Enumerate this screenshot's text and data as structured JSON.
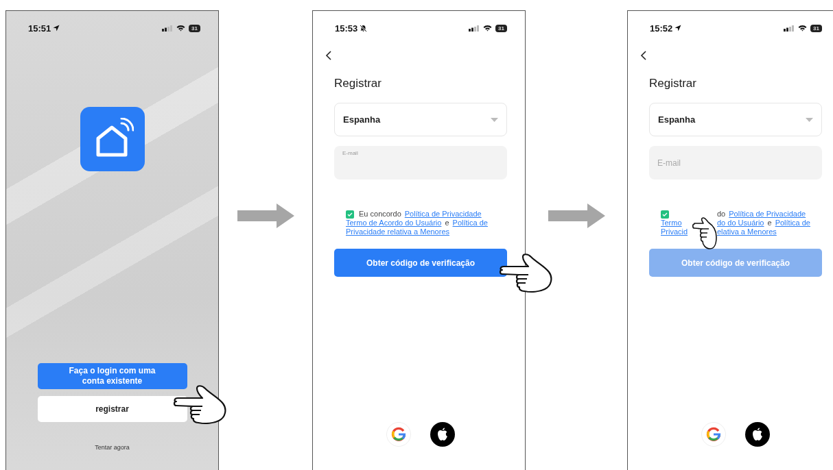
{
  "screens": [
    {
      "kind": "welcome",
      "status": {
        "time": "15:51",
        "indicator": {
          "kind": "location"
        },
        "battery": "31"
      },
      "login_button": "Faça o login com uma conta existente",
      "register_button": "registrar",
      "try_link": "Tentar agora",
      "pointer": {
        "kind": "register"
      }
    },
    {
      "kind": "register",
      "status": {
        "time": "15:53",
        "indicator": {
          "kind": "muted"
        },
        "battery": "31"
      },
      "title": "Registrar",
      "country": "Espanha",
      "email": {
        "placeholder": "E-mail",
        "focused": true
      },
      "consent": {
        "checked": true,
        "lines": [
          {
            "pieces": [
              {
                "text": "Eu concordo",
                "kind": "plain"
              },
              {
                "text": "Política de Privacidade",
                "kind": "link"
              }
            ]
          },
          {
            "pieces": [
              {
                "text": "Termo de Acordo do Usuário",
                "kind": "link"
              },
              {
                "text": "e",
                "kind": "plain"
              },
              {
                "text": "Política de",
                "kind": "link"
              }
            ]
          },
          {
            "pieces": [
              {
                "text": "Privacidade relativa a Menores",
                "kind": "link"
              }
            ]
          }
        ]
      },
      "submit": {
        "label": "Obter código de verificação",
        "disabled": false
      },
      "pointer": {
        "kind": "submit"
      }
    },
    {
      "kind": "register",
      "status": {
        "time": "15:52",
        "indicator": {
          "kind": "location"
        },
        "battery": "31"
      },
      "title": "Registrar",
      "country": "Espanha",
      "email": {
        "placeholder": "E-mail",
        "focused": false
      },
      "consent": {
        "checked": true,
        "lines": [
          {
            "after_hand": [
              {
                "text": "do",
                "kind": "plain"
              },
              {
                "text": "Política de Privacidade",
                "kind": "link"
              }
            ]
          },
          {
            "before_hand": [
              {
                "text": "Termo",
                "kind": "link"
              }
            ],
            "after_hand": [
              {
                "text": "do do Usuário",
                "kind": "link"
              },
              {
                "text": "e",
                "kind": "plain"
              },
              {
                "text": "Política de",
                "kind": "link"
              }
            ]
          },
          {
            "before_hand": [
              {
                "text": "Privacid",
                "kind": "link"
              }
            ],
            "after_hand": [
              {
                "text": "elativa a Menores",
                "kind": "link"
              }
            ]
          }
        ]
      },
      "submit": {
        "label": "Obter código de verificação",
        "disabled": true
      },
      "pointer": {
        "kind": "consent"
      }
    }
  ]
}
